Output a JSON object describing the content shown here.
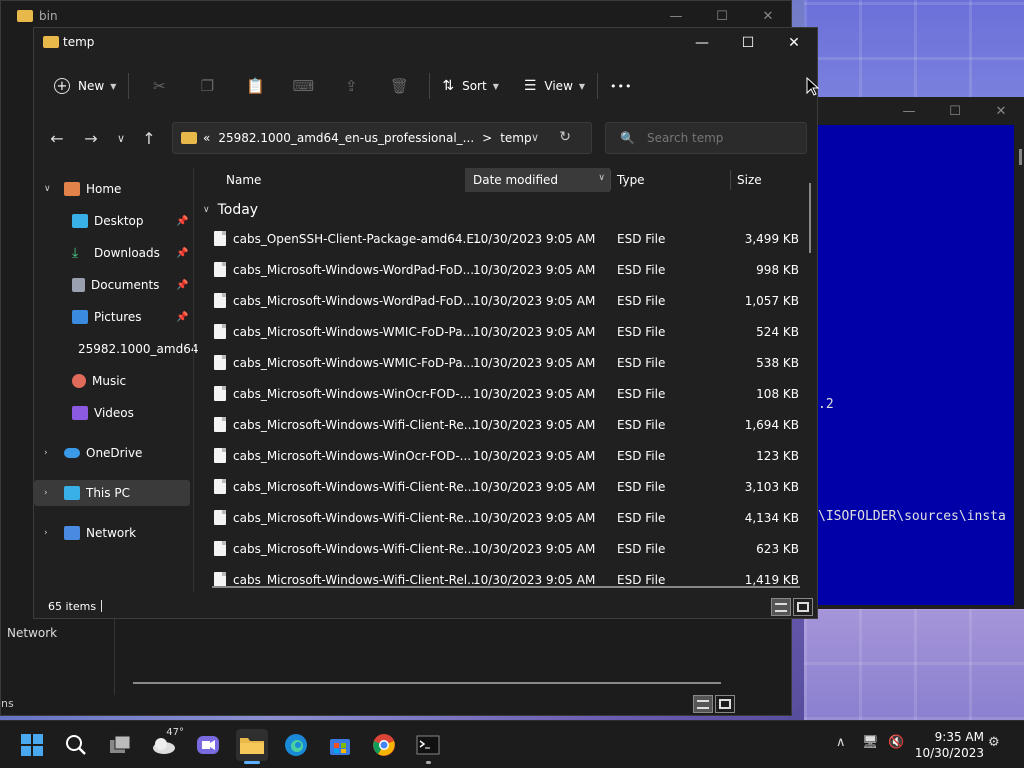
{
  "bin_window": {
    "title": "bin",
    "nav_network": "Network",
    "status_fragment": "ns"
  },
  "cmd_window": {
    "line1": ".2",
    "line2": "\\ISOFOLDER\\sources\\insta"
  },
  "explorer": {
    "title": "temp",
    "toolbar": {
      "new_label": "New",
      "sort_label": "Sort",
      "view_label": "View",
      "more_label": "•••"
    },
    "address": {
      "crumb_prefix": "«",
      "crumb1": "25982.1000_amd64_en-us_professional_...",
      "crumb_sep": ">",
      "crumb2": "temp"
    },
    "search": {
      "placeholder": "Search temp"
    },
    "sidebar": {
      "home": "Home",
      "desktop": "Desktop",
      "downloads": "Downloads",
      "documents": "Documents",
      "pictures": "Pictures",
      "folder_25982": "25982.1000_amd64",
      "music": "Music",
      "videos": "Videos",
      "onedrive": "OneDrive",
      "thispc": "This PC",
      "network": "Network"
    },
    "columns": {
      "name": "Name",
      "date": "Date modified",
      "type": "Type",
      "size": "Size"
    },
    "group_label": "Today",
    "files": [
      {
        "name": "cabs_OpenSSH-Client-Package-amd64.E...",
        "date": "10/30/2023 9:05 AM",
        "type": "ESD File",
        "size": "3,499 KB"
      },
      {
        "name": "cabs_Microsoft-Windows-WordPad-FoD...",
        "date": "10/30/2023 9:05 AM",
        "type": "ESD File",
        "size": "998 KB"
      },
      {
        "name": "cabs_Microsoft-Windows-WordPad-FoD...",
        "date": "10/30/2023 9:05 AM",
        "type": "ESD File",
        "size": "1,057 KB"
      },
      {
        "name": "cabs_Microsoft-Windows-WMIC-FoD-Pa...",
        "date": "10/30/2023 9:05 AM",
        "type": "ESD File",
        "size": "524 KB"
      },
      {
        "name": "cabs_Microsoft-Windows-WMIC-FoD-Pa...",
        "date": "10/30/2023 9:05 AM",
        "type": "ESD File",
        "size": "538 KB"
      },
      {
        "name": "cabs_Microsoft-Windows-WinOcr-FOD-...",
        "date": "10/30/2023 9:05 AM",
        "type": "ESD File",
        "size": "108 KB"
      },
      {
        "name": "cabs_Microsoft-Windows-Wifi-Client-Re...",
        "date": "10/30/2023 9:05 AM",
        "type": "ESD File",
        "size": "1,694 KB"
      },
      {
        "name": "cabs_Microsoft-Windows-WinOcr-FOD-...",
        "date": "10/30/2023 9:05 AM",
        "type": "ESD File",
        "size": "123 KB"
      },
      {
        "name": "cabs_Microsoft-Windows-Wifi-Client-Re...",
        "date": "10/30/2023 9:05 AM",
        "type": "ESD File",
        "size": "3,103 KB"
      },
      {
        "name": "cabs_Microsoft-Windows-Wifi-Client-Re...",
        "date": "10/30/2023 9:05 AM",
        "type": "ESD File",
        "size": "4,134 KB"
      },
      {
        "name": "cabs_Microsoft-Windows-Wifi-Client-Re...",
        "date": "10/30/2023 9:05 AM",
        "type": "ESD File",
        "size": "623 KB"
      },
      {
        "name": "cabs_Microsoft-Windows-Wifi-Client-Rel...",
        "date": "10/30/2023 9:05 AM",
        "type": "ESD File",
        "size": "1,419 KB"
      }
    ],
    "status": {
      "item_count": "65 items"
    }
  },
  "taskbar": {
    "weather_temp": "47°",
    "time": "9:35 AM",
    "date": "10/30/2023"
  },
  "colors": {
    "folder": "#e8b84a",
    "accent": "#5ab0ff",
    "cmd_bg": "#0000a8",
    "window_bg": "#202020"
  }
}
